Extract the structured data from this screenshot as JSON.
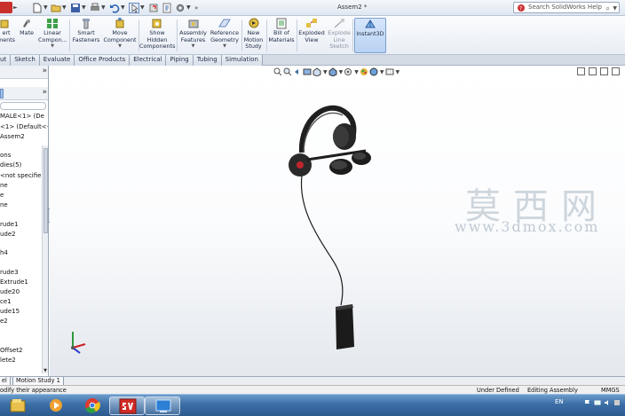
{
  "window": {
    "title": "Assem2 *",
    "help_search_placeholder": "Search SolidWorks Help"
  },
  "command_manager": [
    {
      "label_line1": "ert",
      "label_line2": "ments",
      "icon": "insert-components-icon"
    },
    {
      "label_line1": "Mate",
      "label_line2": "",
      "icon": "mate-icon"
    },
    {
      "label_line1": "Linear",
      "label_line2": "Compon...",
      "icon": "linear-pattern-icon"
    },
    {
      "label_line1": "Smart",
      "label_line2": "Fasteners",
      "icon": "smart-fasteners-icon"
    },
    {
      "label_line1": "Move",
      "label_line2": "Component",
      "icon": "move-component-icon"
    },
    {
      "label_line1": "Show",
      "label_line2": "Hidden",
      "label_line3": "Components",
      "icon": "show-hidden-icon"
    },
    {
      "label_line1": "Assembly",
      "label_line2": "Features",
      "icon": "assembly-features-icon"
    },
    {
      "label_line1": "Reference",
      "label_line2": "Geometry",
      "icon": "reference-geometry-icon"
    },
    {
      "label_line1": "New",
      "label_line2": "Motion",
      "label_line3": "Study",
      "icon": "new-motion-study-icon"
    },
    {
      "label_line1": "Bill of",
      "label_line2": "Materials",
      "icon": "bill-of-materials-icon"
    },
    {
      "label_line1": "Exploded",
      "label_line2": "View",
      "icon": "exploded-view-icon"
    },
    {
      "label_line1": "Explode",
      "label_line2": "Line",
      "label_line3": "Sketch",
      "icon": "explode-line-sketch-icon"
    },
    {
      "label_line1": "Instant3D",
      "label_line2": "",
      "icon": "instant3d-icon"
    }
  ],
  "tabs": [
    "ut",
    "Sketch",
    "Evaluate",
    "Office Products",
    "Electrical",
    "Piping",
    "Tubing",
    "Simulation"
  ],
  "feature_tree": [
    "MALE<1> (De",
    "<1> (Default<-",
    "Assem2",
    "",
    "ons",
    "dies(5)",
    "<not specifie",
    "ne",
    "e",
    "ne",
    "",
    "rude1",
    "ude2",
    "",
    "h4",
    "",
    "rude3",
    "Extrude1",
    "ude20",
    "ce1",
    "ude15",
    "e2",
    "",
    "",
    "Offset2",
    "lete2"
  ],
  "watermark": {
    "chinese": "莫西网",
    "url": "www.3dmox.com"
  },
  "bottom_tabs": [
    "el",
    "Motion Study 1"
  ],
  "status": {
    "hint": "odify their appearance",
    "state": "Under Defined",
    "mode": "Editing Assembly",
    "units": "MMGS"
  },
  "taskbar": {
    "apps": [
      "windows-explorer-icon",
      "media-player-icon",
      "chrome-icon",
      "solidworks-icon",
      "desktop-app-icon"
    ],
    "language": "EN"
  },
  "colors": {
    "accent": "#3b6ea6",
    "model_body": "#2a2a2a",
    "model_highlight": "#c0262b"
  }
}
